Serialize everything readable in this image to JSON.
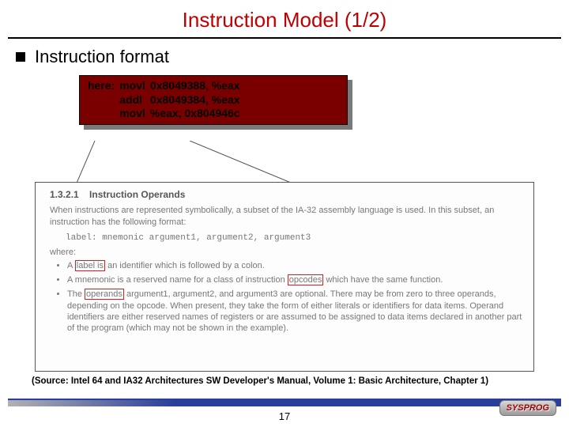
{
  "title": "Instruction Model (1/2)",
  "section_bullet": "Instruction format",
  "code": {
    "label": "here:",
    "lines": [
      {
        "mnemonic": "movl",
        "args": "0x8049388, %eax"
      },
      {
        "mnemonic": "addl",
        "args": "0x8049384, %eax"
      },
      {
        "mnemonic": "movl",
        "args": "%eax, 0x804946c"
      }
    ]
  },
  "excerpt": {
    "heading_num": "1.3.2.1",
    "heading_text": "Instruction Operands",
    "para1": "When instructions are represented symbolically, a subset of the IA-32 assembly language is used. In this subset, an instruction has the following format:",
    "format_line": "label: mnemonic argument1, argument2, argument3",
    "where": "where:",
    "li1_pre": "A ",
    "li1_box": "label is",
    "li1_post": " an identifier which is followed by a colon.",
    "li2_pre": "A mnemonic is a reserved name for a class of instruction ",
    "li2_box": "opcodes",
    "li2_post": " which have the same function.",
    "li3_pre": "The ",
    "li3_box": "operands",
    "li3_post": " argument1, argument2, and argument3 are optional. There may be from zero to three operands, depending on the opcode. When present, they take the form of either literals or identifiers for data items. Operand identifiers are either reserved names of registers or are assumed to be assigned to data items declared in another part of the program (which may not be shown in the example)."
  },
  "source_line": "(Source: Intel 64 and IA32 Architectures SW Developer's Manual, Volume 1: Basic Architecture, Chapter 1)",
  "page_number": "17",
  "logo_text": "SYSPROG"
}
